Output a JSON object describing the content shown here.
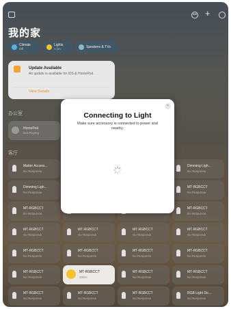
{
  "topbar": {
    "more_symbol": "•••",
    "add_symbol": "+"
  },
  "home": {
    "title": "我的家"
  },
  "chips": [
    {
      "label": "Climate",
      "sub": "Off",
      "color": "#5ab0e0",
      "icon": "thermometer-icon"
    },
    {
      "label": "Lights",
      "sub": "1 On",
      "color": "#f5c330",
      "icon": "lightbulb-icon"
    },
    {
      "label": "Speakers & TVs",
      "sub": "",
      "color": "#8fb7cc",
      "icon": "speaker-icon"
    }
  ],
  "update": {
    "title": "Update Available",
    "description": "An update is available for iOS & HomePod.",
    "link": "View Details"
  },
  "sections": {
    "room": "办公室",
    "accessories": "客厅"
  },
  "homepod": {
    "name": "HomePod",
    "status": "Not Playing"
  },
  "tiles": [
    {
      "name": "Matter Access...",
      "status": "No Response",
      "on": false
    },
    {
      "name": "",
      "status": "",
      "on": false
    },
    {
      "name": "",
      "status": "",
      "on": false
    },
    {
      "name": "Dimming Ligh...",
      "status": "No Response",
      "on": false
    },
    {
      "name": "Dimming Ligh...",
      "status": "No Response",
      "on": false
    },
    {
      "name": "",
      "status": "",
      "on": false
    },
    {
      "name": "",
      "status": "",
      "on": false
    },
    {
      "name": "MT-RGBCCT",
      "status": "No Response",
      "on": false
    },
    {
      "name": "MT-RGBCCT",
      "status": "No Response",
      "on": false
    },
    {
      "name": "",
      "status": "",
      "on": false
    },
    {
      "name": "",
      "status": "",
      "on": false
    },
    {
      "name": "MT-RGBCCT",
      "status": "No Response",
      "on": false
    },
    {
      "name": "MT-RGBCCT",
      "status": "No Response",
      "on": false
    },
    {
      "name": "MT-RGBCCT",
      "status": "No Response",
      "on": false
    },
    {
      "name": "MT-RGBCCT",
      "status": "No Response",
      "on": false
    },
    {
      "name": "MT-RGBCCT",
      "status": "No Response",
      "on": false
    },
    {
      "name": "MT-RGBCCT",
      "status": "No Response",
      "on": false
    },
    {
      "name": "MT-RGBCCT",
      "status": "No Response",
      "on": false
    },
    {
      "name": "MT-RGBCCT",
      "status": "No Response",
      "on": false
    },
    {
      "name": "MT-RGBCCT",
      "status": "No Response",
      "on": false
    },
    {
      "name": "MT-RGBCCT",
      "status": "No Response",
      "on": false
    },
    {
      "name": "MT-RGBCCT",
      "status": "100%",
      "on": true
    },
    {
      "name": "MT-RGBCCT",
      "status": "No Response",
      "on": false
    },
    {
      "name": "MT-RGBCCT",
      "status": "No Response",
      "on": false
    },
    {
      "name": "MT-RGBCCT",
      "status": "No Response",
      "on": false
    },
    {
      "name": "MT-RGBCCT",
      "status": "No Response",
      "on": false
    },
    {
      "name": "MT-RGBCCT",
      "status": "No Response",
      "on": false
    },
    {
      "name": "RGB Light De...",
      "status": "No Response",
      "on": false
    }
  ],
  "modal": {
    "title": "Connecting to Light",
    "description": "Make sure accessory is connected to power and nearby.",
    "close_symbol": "×"
  }
}
